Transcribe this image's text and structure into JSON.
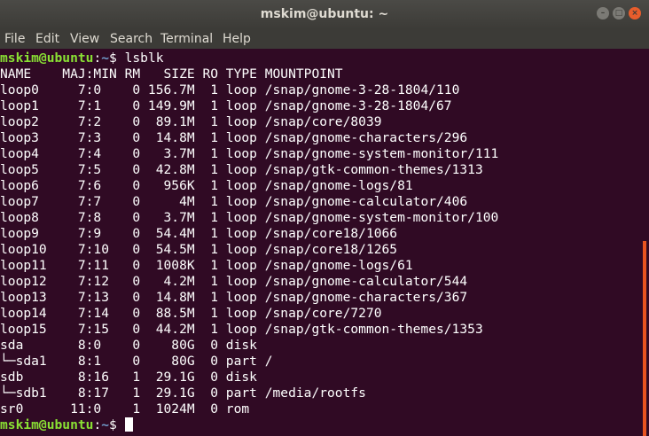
{
  "window": {
    "title": "mskim@ubuntu: ~"
  },
  "window_controls": {
    "minimize": "–",
    "maximize": "□",
    "close": "×"
  },
  "menu": {
    "items": [
      "File",
      "Edit",
      "View",
      "Search",
      "Terminal",
      "Help"
    ]
  },
  "prompt": {
    "userhost": "mskim@ubuntu",
    "sep": ":",
    "path": "~",
    "sign": "$"
  },
  "command": " lsblk",
  "output": [
    "NAME    MAJ:MIN RM   SIZE RO TYPE MOUNTPOINT",
    "loop0     7:0    0 156.7M  1 loop /snap/gnome-3-28-1804/110",
    "loop1     7:1    0 149.9M  1 loop /snap/gnome-3-28-1804/67",
    "loop2     7:2    0  89.1M  1 loop /snap/core/8039",
    "loop3     7:3    0  14.8M  1 loop /snap/gnome-characters/296",
    "loop4     7:4    0   3.7M  1 loop /snap/gnome-system-monitor/111",
    "loop5     7:5    0  42.8M  1 loop /snap/gtk-common-themes/1313",
    "loop6     7:6    0   956K  1 loop /snap/gnome-logs/81",
    "loop7     7:7    0     4M  1 loop /snap/gnome-calculator/406",
    "loop8     7:8    0   3.7M  1 loop /snap/gnome-system-monitor/100",
    "loop9     7:9    0  54.4M  1 loop /snap/core18/1066",
    "loop10    7:10   0  54.5M  1 loop /snap/core18/1265",
    "loop11    7:11   0  1008K  1 loop /snap/gnome-logs/61",
    "loop12    7:12   0   4.2M  1 loop /snap/gnome-calculator/544",
    "loop13    7:13   0  14.8M  1 loop /snap/gnome-characters/367",
    "loop14    7:14   0  88.5M  1 loop /snap/core/7270",
    "loop15    7:15   0  44.2M  1 loop /snap/gtk-common-themes/1353",
    "sda       8:0    0    80G  0 disk",
    "└─sda1    8:1    0    80G  0 part /",
    "sdb       8:16   1  29.1G  0 disk",
    "└─sdb1    8:17   1  29.1G  0 part /media/rootfs",
    "sr0      11:0    1  1024M  0 rom"
  ],
  "colors": {
    "background": "#300a24",
    "prompt_user": "#8ae234",
    "prompt_path": "#729fcf",
    "scrollbar": "#e95420"
  }
}
